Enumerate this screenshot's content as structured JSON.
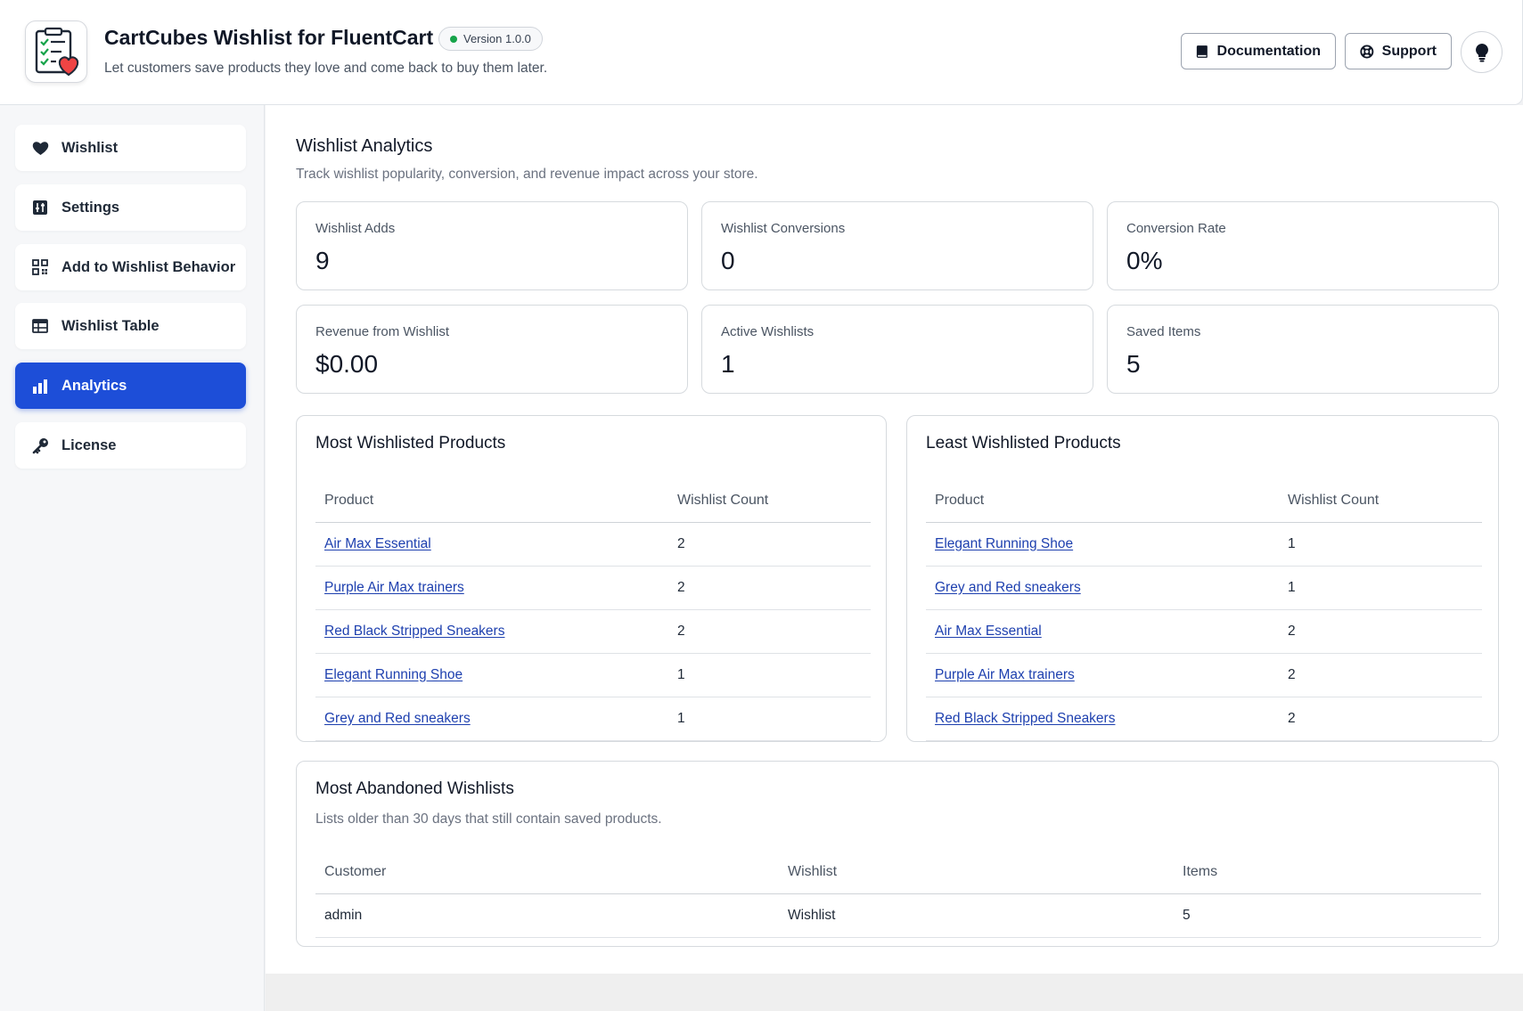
{
  "header": {
    "title": "CartCubes Wishlist for FluentCart",
    "version": "Version 1.0.0",
    "subtitle": "Let customers save products they love and come back to buy them later.",
    "documentation_label": "Documentation",
    "support_label": "Support"
  },
  "sidebar": {
    "items": [
      {
        "label": "Wishlist",
        "icon": "heart-icon"
      },
      {
        "label": "Settings",
        "icon": "sliders-icon"
      },
      {
        "label": "Add to Wishlist Behavior",
        "icon": "qr-grid-icon"
      },
      {
        "label": "Wishlist Table",
        "icon": "table-icon"
      },
      {
        "label": "Analytics",
        "icon": "bar-chart-icon",
        "active": true
      },
      {
        "label": "License",
        "icon": "key-icon"
      }
    ]
  },
  "analytics": {
    "title": "Wishlist Analytics",
    "subtitle": "Track wishlist popularity, conversion, and revenue impact across your store.",
    "stats": [
      {
        "label": "Wishlist Adds",
        "value": "9"
      },
      {
        "label": "Wishlist Conversions",
        "value": "0"
      },
      {
        "label": "Conversion Rate",
        "value": "0%"
      },
      {
        "label": "Revenue from Wishlist",
        "value": "$0.00"
      },
      {
        "label": "Active Wishlists",
        "value": "1"
      },
      {
        "label": "Saved Items",
        "value": "5"
      }
    ]
  },
  "most_wishlisted": {
    "title": "Most Wishlisted Products",
    "columns": [
      "Product",
      "Wishlist Count"
    ],
    "rows": [
      {
        "product": "Air Max Essential",
        "count": "2"
      },
      {
        "product": "Purple Air Max trainers",
        "count": "2"
      },
      {
        "product": "Red Black Stripped Sneakers",
        "count": "2"
      },
      {
        "product": "Elegant Running Shoe",
        "count": "1"
      },
      {
        "product": "Grey and Red sneakers",
        "count": "1"
      }
    ]
  },
  "least_wishlisted": {
    "title": "Least Wishlisted Products",
    "columns": [
      "Product",
      "Wishlist Count"
    ],
    "rows": [
      {
        "product": "Elegant Running Shoe",
        "count": "1"
      },
      {
        "product": "Grey and Red sneakers",
        "count": "1"
      },
      {
        "product": "Air Max Essential",
        "count": "2"
      },
      {
        "product": "Purple Air Max trainers",
        "count": "2"
      },
      {
        "product": "Red Black Stripped Sneakers",
        "count": "2"
      }
    ]
  },
  "abandoned": {
    "title": "Most Abandoned Wishlists",
    "subtitle": "Lists older than 30 days that still contain saved products.",
    "columns": [
      "Customer",
      "Wishlist",
      "Items"
    ],
    "rows": [
      {
        "customer": "admin",
        "wishlist": "Wishlist",
        "items": "5"
      }
    ]
  },
  "colors": {
    "accent": "#1d4ed8",
    "link": "#1e40af",
    "status_green": "#16a34a"
  }
}
